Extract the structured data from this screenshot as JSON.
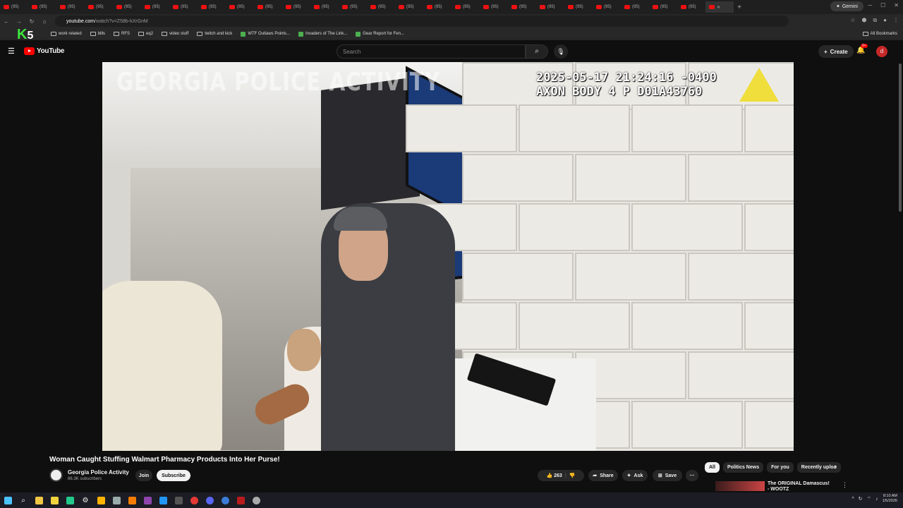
{
  "browser": {
    "tab_prefix": "(95)",
    "tab_count": 26,
    "active_tab_index": 26,
    "gemini_label": "Gemini",
    "url_host": "youtube.com",
    "url_path": "/watch?v=Z58b-kXrGnM",
    "bookmarks": [
      {
        "label": "work related",
        "type": "folder"
      },
      {
        "label": "bills",
        "type": "folder"
      },
      {
        "label": "RFS",
        "type": "folder"
      },
      {
        "label": "eq2",
        "type": "folder"
      },
      {
        "label": "video stuff",
        "type": "folder"
      },
      {
        "label": "twitch and kick",
        "type": "folder"
      },
      {
        "label": "WTF Outlaws Points...",
        "type": "site"
      },
      {
        "label": "Invaders of The Link...",
        "type": "site"
      },
      {
        "label": "Gear Report for Fen...",
        "type": "site"
      }
    ],
    "all_bookmarks_label": "All Bookmarks"
  },
  "overlay_logo": {
    "letter": "K",
    "number": "5"
  },
  "youtube": {
    "logo_text": "YouTube",
    "search_placeholder": "Search",
    "create_label": "Create",
    "notification_count": "9+",
    "avatar_letter": "d"
  },
  "video": {
    "watermark": "GEORGIA POLICE ACTIVITY",
    "timestamp_line": "2025-05-17 21:24:16 -0400",
    "camera_line": "AXON BODY 4 P D01A43760",
    "title": "Woman Caught Stuffing Walmart Pharmacy Products Into Her Purse!",
    "channel_name": "Georgia Police Activity",
    "subscribers": "86.3K subscribers",
    "join_label": "Join",
    "subscribe_label": "Subscribe",
    "like_count": "263",
    "share_label": "Share",
    "ask_label": "Ask",
    "save_label": "Save"
  },
  "chips": [
    "All",
    "Politics News",
    "For you",
    "Recently uploa"
  ],
  "recommendation": {
    "title": "The ORIGINAL Damascus! - WOOTZ"
  },
  "taskbar": {
    "time": "8:10 AM",
    "date": "1/5/2026"
  },
  "colors": {
    "youtube_red": "#ff0000",
    "background": "#0f0f0f",
    "k5_green": "#3ee63e"
  }
}
